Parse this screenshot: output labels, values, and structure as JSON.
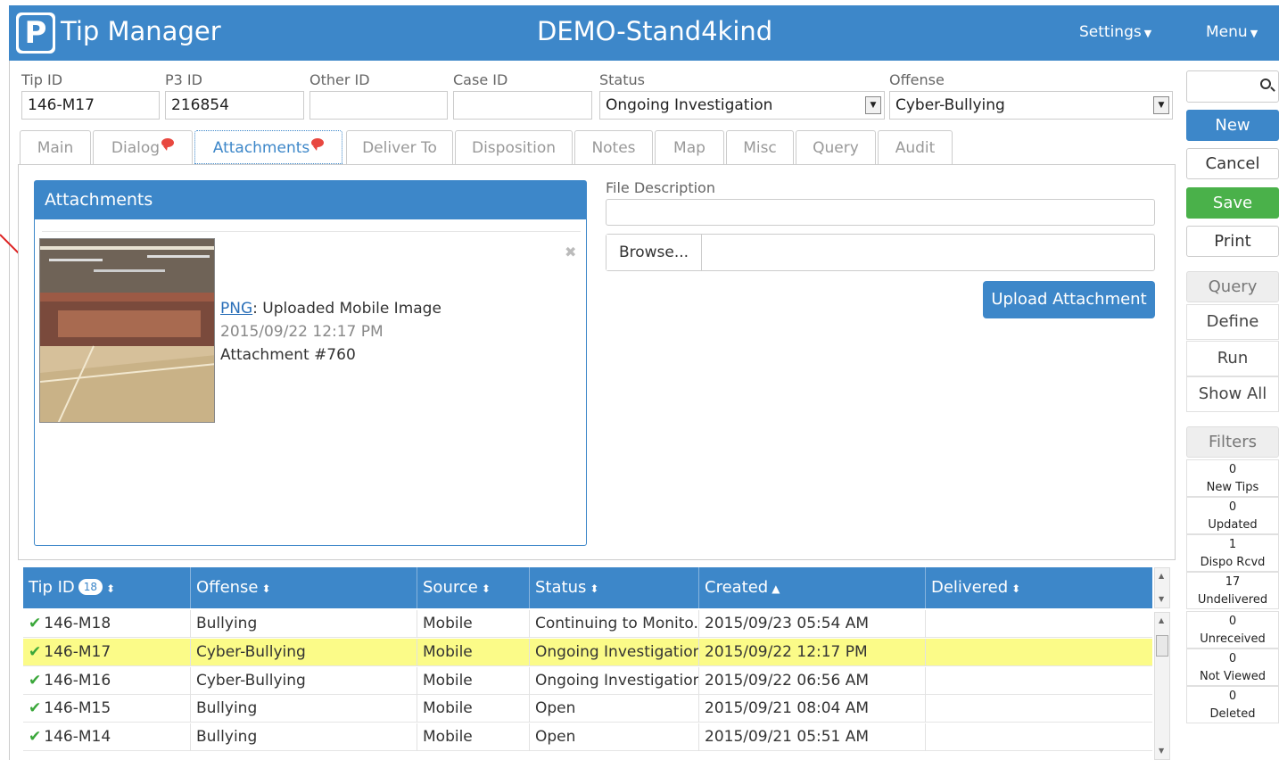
{
  "header": {
    "app_title": "Tip Manager",
    "logo_text": "P",
    "site_title": "DEMO-Stand4kind",
    "settings_label": "Settings",
    "menu_label": "Menu",
    "bg_color": "#3d87c9"
  },
  "fields": {
    "tip_id": {
      "label": "Tip ID",
      "value": "146-M17"
    },
    "p3_id": {
      "label": "P3 ID",
      "value": "216854"
    },
    "other_id": {
      "label": "Other ID",
      "value": ""
    },
    "case_id": {
      "label": "Case ID",
      "value": ""
    },
    "status": {
      "label": "Status",
      "value": "Ongoing Investigation"
    },
    "offense": {
      "label": "Offense",
      "value": "Cyber-Bullying"
    }
  },
  "tabs": [
    {
      "label": "Main",
      "active": false,
      "bubble": false
    },
    {
      "label": "Dialog",
      "active": false,
      "bubble": true
    },
    {
      "label": "Attachments",
      "active": true,
      "bubble": true
    },
    {
      "label": "Deliver To",
      "active": false,
      "bubble": false
    },
    {
      "label": "Disposition",
      "active": false,
      "bubble": false
    },
    {
      "label": "Notes",
      "active": false,
      "bubble": false
    },
    {
      "label": "Map",
      "active": false,
      "bubble": false
    },
    {
      "label": "Misc",
      "active": false,
      "bubble": false
    },
    {
      "label": "Query",
      "active": false,
      "bubble": false
    },
    {
      "label": "Audit",
      "active": false,
      "bubble": false
    }
  ],
  "attachments": {
    "title": "Attachments",
    "close_glyph": "✖",
    "item": {
      "type_link": "PNG",
      "description": ": Uploaded Mobile Image",
      "timestamp": "2015/09/22 12:17 PM",
      "number": "Attachment #760"
    },
    "file_description_label": "File Description",
    "file_description_value": "",
    "browse_label": "Browse...",
    "upload_label": "Upload Attachment"
  },
  "sidebar": {
    "search_value": "",
    "new_label": "New",
    "cancel_label": "Cancel",
    "save_label": "Save",
    "print_label": "Print",
    "query_header": "Query",
    "define_label": "Define",
    "run_label": "Run",
    "show_all_label": "Show All",
    "filters_header": "Filters",
    "filters": [
      {
        "count": "0",
        "label": "New Tips"
      },
      {
        "count": "0",
        "label": "Updated"
      },
      {
        "count": "1",
        "label": "Dispo Rcvd"
      },
      {
        "count": "17",
        "label": "Undelivered"
      },
      {
        "count": "0",
        "label": "Unreceived"
      },
      {
        "count": "0",
        "label": "Not Viewed"
      },
      {
        "count": "0",
        "label": "Deleted"
      }
    ]
  },
  "table": {
    "count": "18",
    "columns": [
      "Tip ID",
      "Offense",
      "Source",
      "Status",
      "Created",
      "Delivered"
    ],
    "rows": [
      {
        "tip_id": "146-M18",
        "offense": "Bullying",
        "source": "Mobile",
        "status": "Continuing to Monito...",
        "created": "2015/09/23 05:54 AM",
        "delivered": "",
        "highlight": false
      },
      {
        "tip_id": "146-M17",
        "offense": "Cyber-Bullying",
        "source": "Mobile",
        "status": "Ongoing Investigation",
        "created": "2015/09/22 12:17 PM",
        "delivered": "",
        "highlight": true
      },
      {
        "tip_id": "146-M16",
        "offense": "Cyber-Bullying",
        "source": "Mobile",
        "status": "Ongoing Investigation",
        "created": "2015/09/22 06:56 AM",
        "delivered": "",
        "highlight": false
      },
      {
        "tip_id": "146-M15",
        "offense": "Bullying",
        "source": "Mobile",
        "status": "Open",
        "created": "2015/09/21 08:04 AM",
        "delivered": "",
        "highlight": false
      },
      {
        "tip_id": "146-M14",
        "offense": "Bullying",
        "source": "Mobile",
        "status": "Open",
        "created": "2015/09/21 05:51 AM",
        "delivered": "",
        "highlight": false
      }
    ]
  }
}
